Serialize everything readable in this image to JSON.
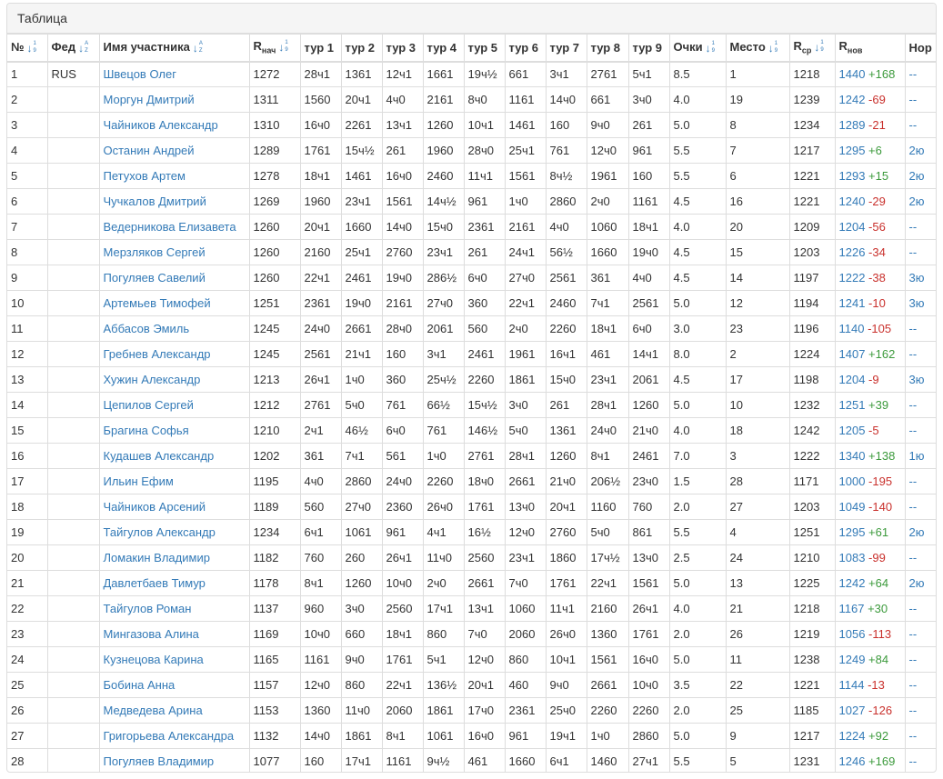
{
  "panel": {
    "title": "Таблица"
  },
  "columns": [
    {
      "key": "num",
      "label": "№",
      "sub": "",
      "sortable": true,
      "sort_glyph": "↓",
      "sort_top": "1",
      "sort_bottom": "9"
    },
    {
      "key": "fed",
      "label": "Фед",
      "sub": "",
      "sortable": true,
      "sort_glyph": "↓",
      "sort_top": "A",
      "sort_bottom": "Z"
    },
    {
      "key": "name",
      "label": "Имя участника",
      "sub": "",
      "sortable": true,
      "sort_glyph": "↓",
      "sort_top": "A",
      "sort_bottom": "Z"
    },
    {
      "key": "rstart",
      "label": "R",
      "sub": "нач",
      "sortable": true,
      "sort_glyph": "↓",
      "sort_top": "1",
      "sort_bottom": "9"
    },
    {
      "key": "r1",
      "label": "тур 1",
      "sub": "",
      "sortable": false
    },
    {
      "key": "r2",
      "label": "тур 2",
      "sub": "",
      "sortable": false
    },
    {
      "key": "r3",
      "label": "тур 3",
      "sub": "",
      "sortable": false
    },
    {
      "key": "r4",
      "label": "тур 4",
      "sub": "",
      "sortable": false
    },
    {
      "key": "r5",
      "label": "тур 5",
      "sub": "",
      "sortable": false
    },
    {
      "key": "r6",
      "label": "тур 6",
      "sub": "",
      "sortable": false
    },
    {
      "key": "r7",
      "label": "тур 7",
      "sub": "",
      "sortable": false
    },
    {
      "key": "r8",
      "label": "тур 8",
      "sub": "",
      "sortable": false
    },
    {
      "key": "r9",
      "label": "тур 9",
      "sub": "",
      "sortable": false
    },
    {
      "key": "points",
      "label": "Очки",
      "sub": "",
      "sortable": true,
      "sort_glyph": "↓",
      "sort_top": "1",
      "sort_bottom": "9"
    },
    {
      "key": "place",
      "label": "Место",
      "sub": "",
      "sortable": true,
      "sort_glyph": "↓",
      "sort_top": "1",
      "sort_bottom": "9"
    },
    {
      "key": "ravg",
      "label": "R",
      "sub": "ср",
      "sortable": true,
      "sort_glyph": "↓",
      "sort_top": "1",
      "sort_bottom": "9"
    },
    {
      "key": "rnew",
      "label": "R",
      "sub": "нов",
      "sortable": false
    },
    {
      "key": "norm",
      "label": "Нор",
      "sub": "",
      "sortable": false
    }
  ],
  "rows": [
    {
      "num": "1",
      "fed": "RUS",
      "name": "Швецов Олег",
      "rstart": "1272",
      "r": [
        "28ч1",
        "1361",
        "12ч1",
        "1661",
        "19ч½",
        "661",
        "3ч1",
        "2761",
        "5ч1"
      ],
      "points": "8.5",
      "place": "1",
      "ravg": "1218",
      "rnew": "1440",
      "delta": "+168",
      "norm": "--"
    },
    {
      "num": "2",
      "fed": "",
      "name": "Моргун Дмитрий",
      "rstart": "1311",
      "r": [
        "1560",
        "20ч1",
        "4ч0",
        "2161",
        "8ч0",
        "1161",
        "14ч0",
        "661",
        "3ч0"
      ],
      "points": "4.0",
      "place": "19",
      "ravg": "1239",
      "rnew": "1242",
      "delta": "-69",
      "norm": "--"
    },
    {
      "num": "3",
      "fed": "",
      "name": "Чайников Александр",
      "rstart": "1310",
      "r": [
        "16ч0",
        "2261",
        "13ч1",
        "1260",
        "10ч1",
        "1461",
        "160",
        "9ч0",
        "261"
      ],
      "points": "5.0",
      "place": "8",
      "ravg": "1234",
      "rnew": "1289",
      "delta": "-21",
      "norm": "--"
    },
    {
      "num": "4",
      "fed": "",
      "name": "Останин Андрей",
      "rstart": "1289",
      "r": [
        "1761",
        "15ч½",
        "261",
        "1960",
        "28ч0",
        "25ч1",
        "761",
        "12ч0",
        "961"
      ],
      "points": "5.5",
      "place": "7",
      "ravg": "1217",
      "rnew": "1295",
      "delta": "+6",
      "norm": "2ю"
    },
    {
      "num": "5",
      "fed": "",
      "name": "Петухов Артем",
      "rstart": "1278",
      "r": [
        "18ч1",
        "1461",
        "16ч0",
        "2460",
        "11ч1",
        "1561",
        "8ч½",
        "1961",
        "160"
      ],
      "points": "5.5",
      "place": "6",
      "ravg": "1221",
      "rnew": "1293",
      "delta": "+15",
      "norm": "2ю"
    },
    {
      "num": "6",
      "fed": "",
      "name": "Чучкалов Дмитрий",
      "rstart": "1269",
      "r": [
        "1960",
        "23ч1",
        "1561",
        "14ч½",
        "961",
        "1ч0",
        "2860",
        "2ч0",
        "1161"
      ],
      "points": "4.5",
      "place": "16",
      "ravg": "1221",
      "rnew": "1240",
      "delta": "-29",
      "norm": "2ю"
    },
    {
      "num": "7",
      "fed": "",
      "name": "Ведерникова Елизавета",
      "rstart": "1260",
      "r": [
        "20ч1",
        "1660",
        "14ч0",
        "15ч0",
        "2361",
        "2161",
        "4ч0",
        "1060",
        "18ч1"
      ],
      "points": "4.0",
      "place": "20",
      "ravg": "1209",
      "rnew": "1204",
      "delta": "-56",
      "norm": "--"
    },
    {
      "num": "8",
      "fed": "",
      "name": "Мерзляков Сергей",
      "rstart": "1260",
      "r": [
        "2160",
        "25ч1",
        "2760",
        "23ч1",
        "261",
        "24ч1",
        "56½",
        "1660",
        "19ч0"
      ],
      "points": "4.5",
      "place": "15",
      "ravg": "1203",
      "rnew": "1226",
      "delta": "-34",
      "norm": "--"
    },
    {
      "num": "9",
      "fed": "",
      "name": "Погуляев Савелий",
      "rstart": "1260",
      "r": [
        "22ч1",
        "2461",
        "19ч0",
        "286½",
        "6ч0",
        "27ч0",
        "2561",
        "361",
        "4ч0"
      ],
      "points": "4.5",
      "place": "14",
      "ravg": "1197",
      "rnew": "1222",
      "delta": "-38",
      "norm": "3ю"
    },
    {
      "num": "10",
      "fed": "",
      "name": "Артемьев Тимофей",
      "rstart": "1251",
      "r": [
        "2361",
        "19ч0",
        "2161",
        "27ч0",
        "360",
        "22ч1",
        "2460",
        "7ч1",
        "2561"
      ],
      "points": "5.0",
      "place": "12",
      "ravg": "1194",
      "rnew": "1241",
      "delta": "-10",
      "norm": "3ю"
    },
    {
      "num": "11",
      "fed": "",
      "name": "Аббасов Эмиль",
      "rstart": "1245",
      "r": [
        "24ч0",
        "2661",
        "28ч0",
        "2061",
        "560",
        "2ч0",
        "2260",
        "18ч1",
        "6ч0"
      ],
      "points": "3.0",
      "place": "23",
      "ravg": "1196",
      "rnew": "1140",
      "delta": "-105",
      "norm": "--"
    },
    {
      "num": "12",
      "fed": "",
      "name": "Гребнев Александр",
      "rstart": "1245",
      "r": [
        "2561",
        "21ч1",
        "160",
        "3ч1",
        "2461",
        "1961",
        "16ч1",
        "461",
        "14ч1"
      ],
      "points": "8.0",
      "place": "2",
      "ravg": "1224",
      "rnew": "1407",
      "delta": "+162",
      "norm": "--"
    },
    {
      "num": "13",
      "fed": "",
      "name": "Хужин Александр",
      "rstart": "1213",
      "r": [
        "26ч1",
        "1ч0",
        "360",
        "25ч½",
        "2260",
        "1861",
        "15ч0",
        "23ч1",
        "2061"
      ],
      "points": "4.5",
      "place": "17",
      "ravg": "1198",
      "rnew": "1204",
      "delta": "-9",
      "norm": "3ю"
    },
    {
      "num": "14",
      "fed": "",
      "name": "Цепилов Сергей",
      "rstart": "1212",
      "r": [
        "2761",
        "5ч0",
        "761",
        "66½",
        "15ч½",
        "3ч0",
        "261",
        "28ч1",
        "1260"
      ],
      "points": "5.0",
      "place": "10",
      "ravg": "1232",
      "rnew": "1251",
      "delta": "+39",
      "norm": "--"
    },
    {
      "num": "15",
      "fed": "",
      "name": "Брагина Софья",
      "rstart": "1210",
      "r": [
        "2ч1",
        "46½",
        "6ч0",
        "761",
        "146½",
        "5ч0",
        "1361",
        "24ч0",
        "21ч0"
      ],
      "points": "4.0",
      "place": "18",
      "ravg": "1242",
      "rnew": "1205",
      "delta": "-5",
      "norm": "--"
    },
    {
      "num": "16",
      "fed": "",
      "name": "Кудашев Александр",
      "rstart": "1202",
      "r": [
        "361",
        "7ч1",
        "561",
        "1ч0",
        "2761",
        "28ч1",
        "1260",
        "8ч1",
        "2461"
      ],
      "points": "7.0",
      "place": "3",
      "ravg": "1222",
      "rnew": "1340",
      "delta": "+138",
      "norm": "1ю"
    },
    {
      "num": "17",
      "fed": "",
      "name": "Ильин Ефим",
      "rstart": "1195",
      "r": [
        "4ч0",
        "2860",
        "24ч0",
        "2260",
        "18ч0",
        "2661",
        "21ч0",
        "206½",
        "23ч0"
      ],
      "points": "1.5",
      "place": "28",
      "ravg": "1171",
      "rnew": "1000",
      "delta": "-195",
      "norm": "--"
    },
    {
      "num": "18",
      "fed": "",
      "name": "Чайников Арсений",
      "rstart": "1189",
      "r": [
        "560",
        "27ч0",
        "2360",
        "26ч0",
        "1761",
        "13ч0",
        "20ч1",
        "1160",
        "760"
      ],
      "points": "2.0",
      "place": "27",
      "ravg": "1203",
      "rnew": "1049",
      "delta": "-140",
      "norm": "--"
    },
    {
      "num": "19",
      "fed": "",
      "name": "Тайгулов Александр",
      "rstart": "1234",
      "r": [
        "6ч1",
        "1061",
        "961",
        "4ч1",
        "16½",
        "12ч0",
        "2760",
        "5ч0",
        "861"
      ],
      "points": "5.5",
      "place": "4",
      "ravg": "1251",
      "rnew": "1295",
      "delta": "+61",
      "norm": "2ю"
    },
    {
      "num": "20",
      "fed": "",
      "name": "Ломакин Владимир",
      "rstart": "1182",
      "r": [
        "760",
        "260",
        "26ч1",
        "11ч0",
        "2560",
        "23ч1",
        "1860",
        "17ч½",
        "13ч0"
      ],
      "points": "2.5",
      "place": "24",
      "ravg": "1210",
      "rnew": "1083",
      "delta": "-99",
      "norm": "--"
    },
    {
      "num": "21",
      "fed": "",
      "name": "Давлетбаев Тимур",
      "rstart": "1178",
      "r": [
        "8ч1",
        "1260",
        "10ч0",
        "2ч0",
        "2661",
        "7ч0",
        "1761",
        "22ч1",
        "1561"
      ],
      "points": "5.0",
      "place": "13",
      "ravg": "1225",
      "rnew": "1242",
      "delta": "+64",
      "norm": "2ю"
    },
    {
      "num": "22",
      "fed": "",
      "name": "Тайгулов Роман",
      "rstart": "1137",
      "r": [
        "960",
        "3ч0",
        "2560",
        "17ч1",
        "13ч1",
        "1060",
        "11ч1",
        "2160",
        "26ч1"
      ],
      "points": "4.0",
      "place": "21",
      "ravg": "1218",
      "rnew": "1167",
      "delta": "+30",
      "norm": "--"
    },
    {
      "num": "23",
      "fed": "",
      "name": "Мингазова Алина",
      "rstart": "1169",
      "r": [
        "10ч0",
        "660",
        "18ч1",
        "860",
        "7ч0",
        "2060",
        "26ч0",
        "1360",
        "1761"
      ],
      "points": "2.0",
      "place": "26",
      "ravg": "1219",
      "rnew": "1056",
      "delta": "-113",
      "norm": "--"
    },
    {
      "num": "24",
      "fed": "",
      "name": "Кузнецова Карина",
      "rstart": "1165",
      "r": [
        "1161",
        "9ч0",
        "1761",
        "5ч1",
        "12ч0",
        "860",
        "10ч1",
        "1561",
        "16ч0"
      ],
      "points": "5.0",
      "place": "11",
      "ravg": "1238",
      "rnew": "1249",
      "delta": "+84",
      "norm": "--"
    },
    {
      "num": "25",
      "fed": "",
      "name": "Бобина Анна",
      "rstart": "1157",
      "r": [
        "12ч0",
        "860",
        "22ч1",
        "136½",
        "20ч1",
        "460",
        "9ч0",
        "2661",
        "10ч0"
      ],
      "points": "3.5",
      "place": "22",
      "ravg": "1221",
      "rnew": "1144",
      "delta": "-13",
      "norm": "--"
    },
    {
      "num": "26",
      "fed": "",
      "name": "Медведева Арина",
      "rstart": "1153",
      "r": [
        "1360",
        "11ч0",
        "2060",
        "1861",
        "17ч0",
        "2361",
        "25ч0",
        "2260",
        "2260"
      ],
      "points": "2.0",
      "place": "25",
      "ravg": "1185",
      "rnew": "1027",
      "delta": "-126",
      "norm": "--"
    },
    {
      "num": "27",
      "fed": "",
      "name": "Григорьева Александра",
      "rstart": "1132",
      "r": [
        "14ч0",
        "1861",
        "8ч1",
        "1061",
        "16ч0",
        "961",
        "19ч1",
        "1ч0",
        "2860"
      ],
      "points": "5.0",
      "place": "9",
      "ravg": "1217",
      "rnew": "1224",
      "delta": "+92",
      "norm": "--"
    },
    {
      "num": "28",
      "fed": "",
      "name": "Погуляев Владимир",
      "rstart": "1077",
      "r": [
        "160",
        "17ч1",
        "1161",
        "9ч½",
        "461",
        "1660",
        "6ч1",
        "1460",
        "27ч1"
      ],
      "points": "5.5",
      "place": "5",
      "ravg": "1231",
      "rnew": "1246",
      "delta": "+169",
      "norm": "--"
    }
  ],
  "colors": {
    "link": "#337ab7",
    "positive": "#3c9a3c",
    "negative": "#c9302c",
    "border": "#dddddd",
    "heading_bg": "#f5f5f5"
  }
}
